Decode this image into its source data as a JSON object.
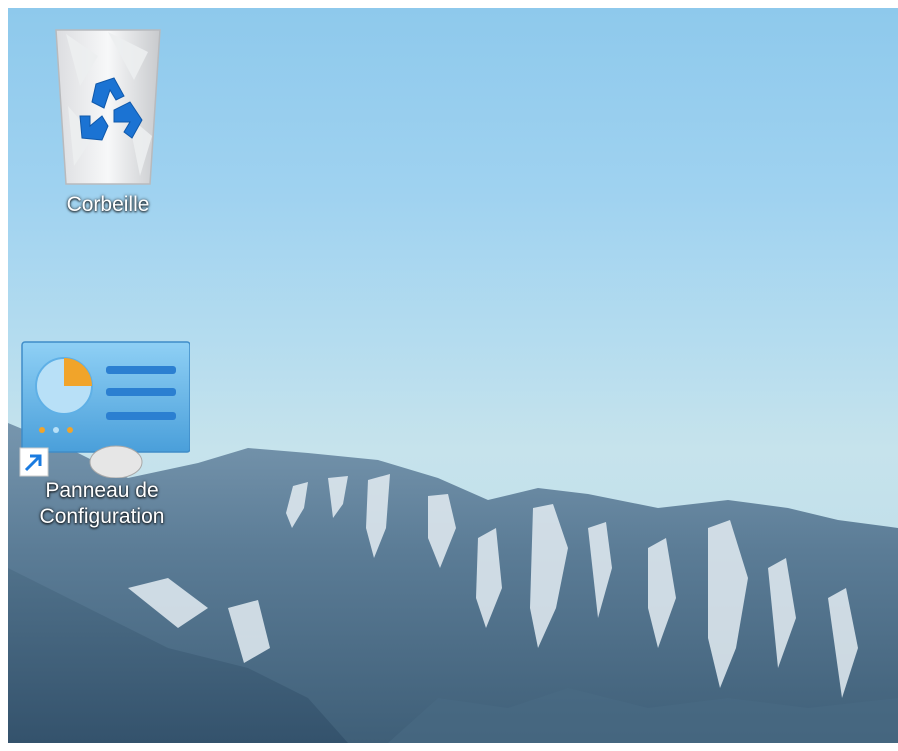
{
  "desktop": {
    "icons": [
      {
        "label": "Corbeille",
        "icon": "recycle-bin-icon"
      },
      {
        "label": "Panneau de\nConfiguration",
        "icon": "control-panel-icon",
        "shortcut": true
      }
    ]
  },
  "colors": {
    "sky_top": "#8ec9ec",
    "mountain": "#5f7f99",
    "snow": "#e6eef4",
    "recycle_arrow": "#1b73d3",
    "shortcut_arrow": "#1a7be0",
    "control_panel_accent": "#f1a42a"
  }
}
